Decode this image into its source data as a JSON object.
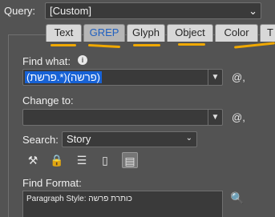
{
  "query": {
    "label": "Query:",
    "value": "[Custom]"
  },
  "tabs": [
    {
      "label": "Text",
      "active": false
    },
    {
      "label": "GREP",
      "active": true
    },
    {
      "label": "Glyph",
      "active": false
    },
    {
      "label": "Object",
      "active": false
    },
    {
      "label": "Color",
      "active": false
    },
    {
      "label": "T",
      "active": false
    }
  ],
  "find_what": {
    "label": "Find what:",
    "value": "(פרשת.*)(פרשה)",
    "special_button": "@,"
  },
  "change_to": {
    "label": "Change to:",
    "value": "",
    "special_button": "@,"
  },
  "search": {
    "label": "Search:",
    "value": "Story"
  },
  "scope_icons": [
    "locked-layers-icon",
    "locked-stories-icon",
    "hidden-layers-icon",
    "master-pages-icon",
    "footnotes-icon"
  ],
  "find_format": {
    "label": "Find Format:",
    "value": "Paragraph Style: כותרת פרשה"
  },
  "colors": {
    "accent_annotation": "#f0a800",
    "selection": "#1762d6",
    "active_tab_text": "#2060c0"
  }
}
